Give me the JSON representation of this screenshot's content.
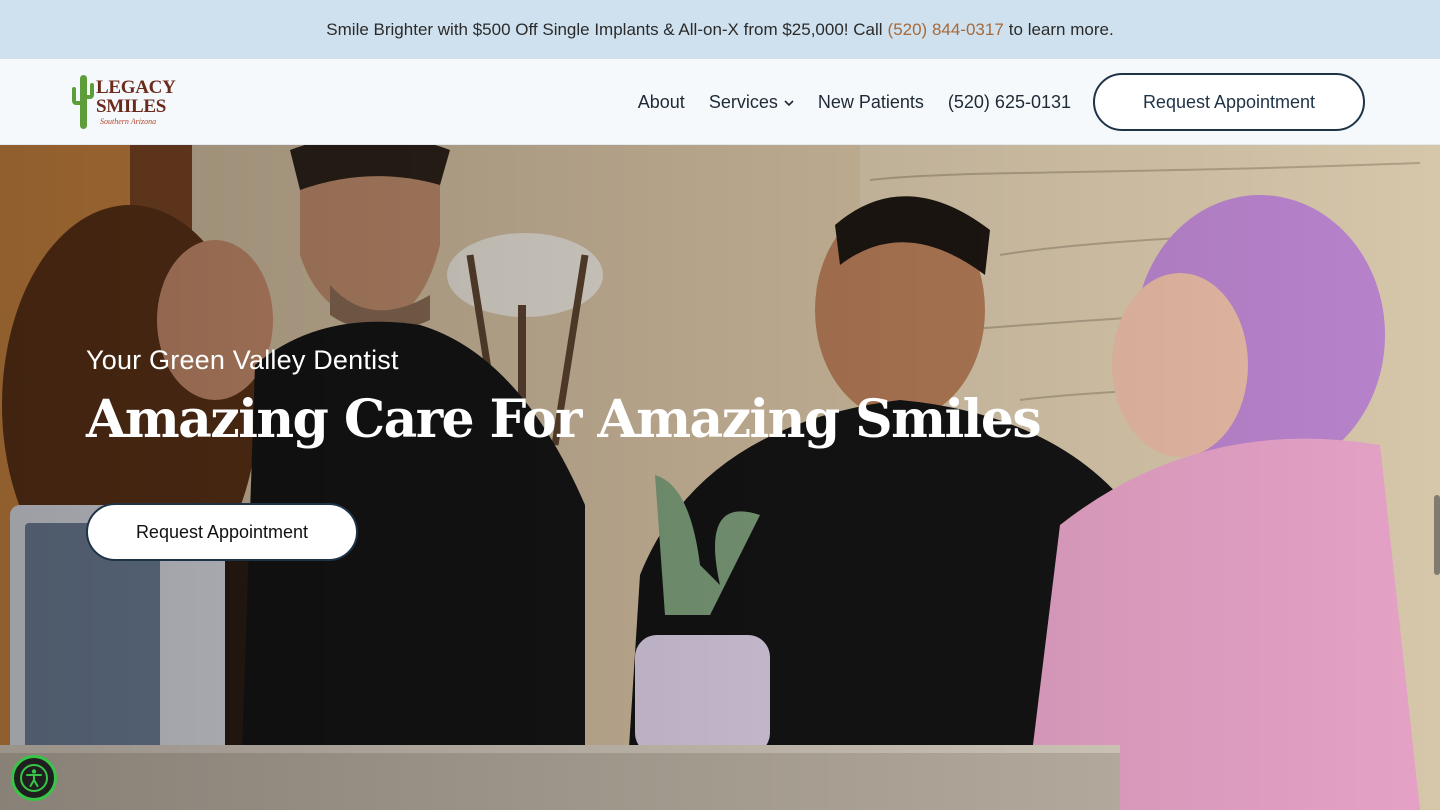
{
  "promo": {
    "text_before": "Smile Brighter with $500 Off Single Implants & All-on-X from $25,000! Call",
    "phone": "(520) 844-0317",
    "text_after": "to learn more."
  },
  "header": {
    "logo": {
      "line1": "LEGACY",
      "line2": "SMILES",
      "line3": "Southern Arizona",
      "icon": "cactus-icon"
    },
    "nav": {
      "about": "About",
      "services": "Services",
      "new_patients": "New Patients",
      "phone": "(520) 625-0131"
    },
    "cta": "Request Appointment"
  },
  "hero": {
    "eyebrow": "Your Green Valley Dentist",
    "headline": "Amazing Care For Amazing Smiles",
    "cta": "Request Appointment"
  },
  "accessibility": {
    "icon": "accessibility-icon"
  },
  "colors": {
    "promo_bg": "#cfe1ee",
    "promo_phone": "#a66a3a",
    "header_bg": "#f5f9fc",
    "button_border": "#1f3347",
    "accessibility_ring": "#38c447",
    "logo_brown": "#6b2a1c"
  }
}
